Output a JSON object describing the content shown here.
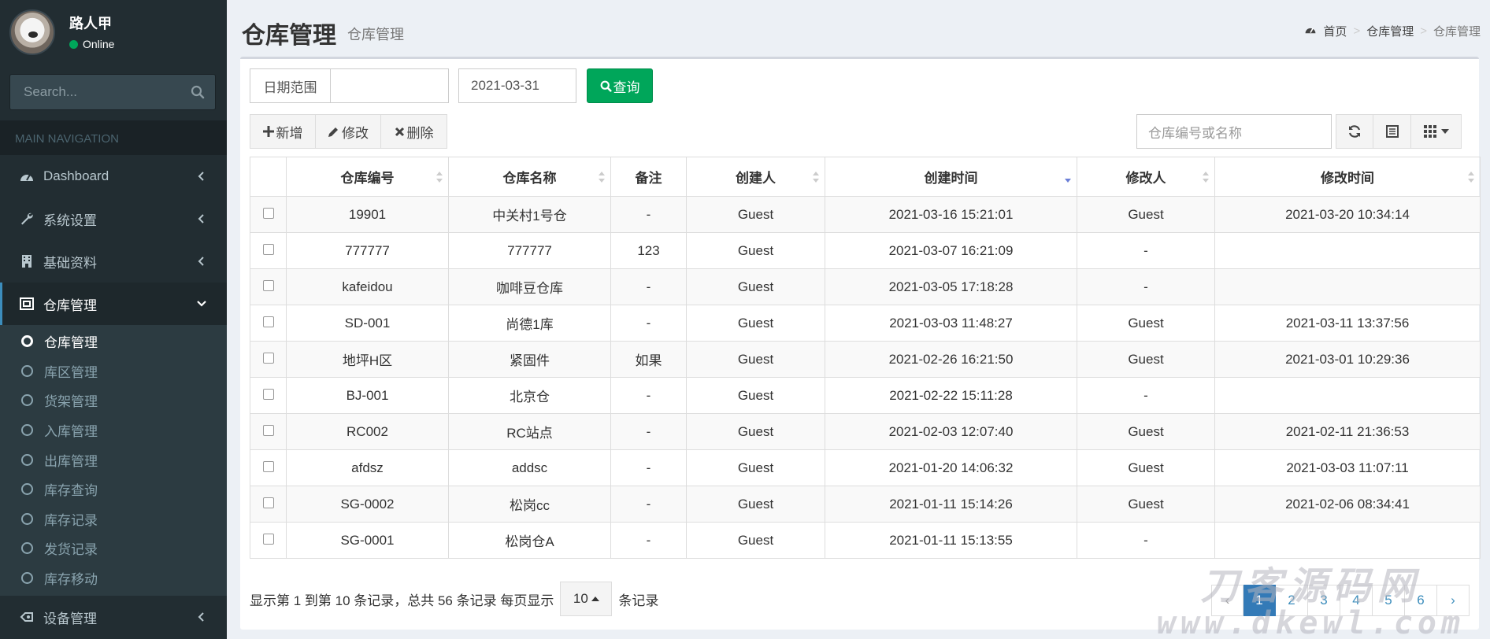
{
  "user": {
    "name": "路人甲",
    "status": "Online"
  },
  "sidebar": {
    "search_placeholder": "Search...",
    "nav_header": "MAIN NAVIGATION",
    "items": [
      {
        "label": "Dashboard",
        "icon": "dashboard-icon"
      },
      {
        "label": "系统设置",
        "icon": "wrench-icon"
      },
      {
        "label": "基础资料",
        "icon": "building-icon"
      },
      {
        "label": "仓库管理",
        "icon": "warehouse-icon",
        "expanded": true
      }
    ],
    "sub_items": [
      "仓库管理",
      "库区管理",
      "货架管理",
      "入库管理",
      "出库管理",
      "库存查询",
      "库存记录",
      "发货记录",
      "库存移动"
    ],
    "last_item": {
      "label": "设备管理",
      "icon": "device-icon"
    }
  },
  "page": {
    "title": "仓库管理",
    "subtitle": "仓库管理"
  },
  "breadcrumb": {
    "home": "首页",
    "level1": "仓库管理",
    "level2": "仓库管理"
  },
  "filter": {
    "date_range_label": "日期范围",
    "start_date": "",
    "end_date": "2021-03-31",
    "query_label": "查询"
  },
  "toolbar": {
    "add_label": "新增",
    "edit_label": "修改",
    "delete_label": "删除"
  },
  "table_search_placeholder": "仓库编号或名称",
  "table": {
    "columns": [
      "仓库编号",
      "仓库名称",
      "备注",
      "创建人",
      "创建时间",
      "修改人",
      "修改时间"
    ],
    "sorted_column": "创建时间",
    "sort_direction": "desc",
    "rows": [
      [
        "19901",
        "中关村1号仓",
        "-",
        "Guest",
        "2021-03-16 15:21:01",
        "Guest",
        "2021-03-20 10:34:14"
      ],
      [
        "777777",
        "777777",
        "123",
        "Guest",
        "2021-03-07 16:21:09",
        "-",
        ""
      ],
      [
        "kafeidou",
        "咖啡豆仓库",
        "-",
        "Guest",
        "2021-03-05 17:18:28",
        "-",
        ""
      ],
      [
        "SD-001",
        "尚德1库",
        "-",
        "Guest",
        "2021-03-03 11:48:27",
        "Guest",
        "2021-03-11 13:37:56"
      ],
      [
        "地坪H区",
        "紧固件",
        "如果",
        "Guest",
        "2021-02-26 16:21:50",
        "Guest",
        "2021-03-01 10:29:36"
      ],
      [
        "BJ-001",
        "北京仓",
        "-",
        "Guest",
        "2021-02-22 15:11:28",
        "-",
        ""
      ],
      [
        "RC002",
        "RC站点",
        "-",
        "Guest",
        "2021-02-03 12:07:40",
        "Guest",
        "2021-02-11 21:36:53"
      ],
      [
        "afdsz",
        "addsc",
        "-",
        "Guest",
        "2021-01-20 14:06:32",
        "Guest",
        "2021-03-03 11:07:11"
      ],
      [
        "SG-0002",
        "松岗cc",
        "-",
        "Guest",
        "2021-01-11 15:14:26",
        "Guest",
        "2021-02-06 08:34:41"
      ],
      [
        "SG-0001",
        "松岗仓A",
        "-",
        "Guest",
        "2021-01-11 15:13:55",
        "-",
        ""
      ]
    ]
  },
  "footer": {
    "summary": "显示第 1 到第 10 条记录，总共 56 条记录 每页显示",
    "page_size": "10",
    "suffix": "条记录"
  },
  "pagination": {
    "prev": "‹",
    "pages": [
      "1",
      "2",
      "3",
      "4",
      "5",
      "6"
    ],
    "active": "1",
    "next": "›"
  },
  "watermark": {
    "logo": "刀客源码网",
    "url": "www.dkewl.com"
  },
  "colors": {
    "sidebar_bg": "#222d32",
    "accent": "#3c8dbc",
    "success": "#00a65a",
    "page_active": "#337ab7"
  }
}
